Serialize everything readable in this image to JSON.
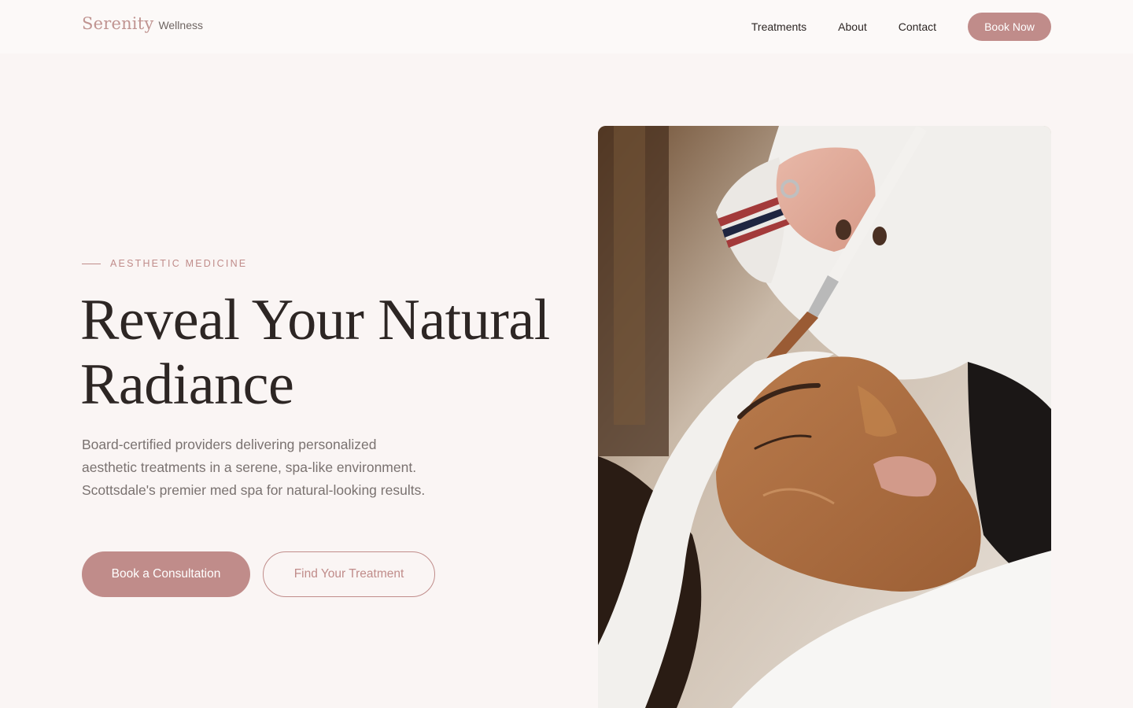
{
  "brand": {
    "name": "Serenity",
    "tagline": "Wellness"
  },
  "nav": {
    "links": [
      "Treatments",
      "About",
      "Contact"
    ],
    "cta": "Book Now"
  },
  "hero": {
    "eyebrow": "AESTHETIC MEDICINE",
    "headline_line1": "Reveal Your Natural",
    "headline_line2": "Radiance",
    "lead": "Board-certified providers delivering personalized aesthetic treatments in a serene, spa-like environment. Scottsdale's premier med spa for natural-looking results.",
    "primary_cta": "Book a Consultation",
    "secondary_cta": "Find Your Treatment"
  },
  "colors": {
    "accent": "#c08c8a",
    "background": "#faf5f4",
    "text": "#2d2624",
    "muted": "#7a7270"
  }
}
